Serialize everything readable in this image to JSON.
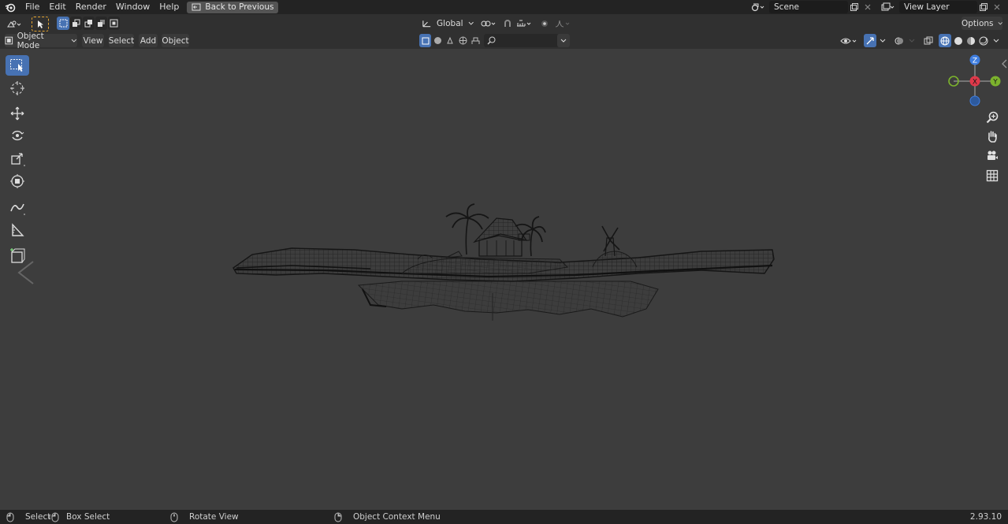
{
  "topbar": {
    "menus": [
      "File",
      "Edit",
      "Render",
      "Window",
      "Help"
    ],
    "back_label": "Back to Previous",
    "scene_name": "Scene",
    "view_layer": "View Layer"
  },
  "toolheader": {
    "orientation": "Global",
    "options_label": "Options"
  },
  "viewheader": {
    "mode": "Object Mode",
    "menus": [
      "View",
      "Select",
      "Add",
      "Object"
    ]
  },
  "gizmo": {
    "z": "Z",
    "x": "X",
    "y": "Y"
  },
  "statusbar": {
    "select": "Select",
    "box_select": "Box Select",
    "rotate_view": "Rotate View",
    "context_menu": "Object Context Menu",
    "version": "2.93.10"
  },
  "colors": {
    "accent": "#4772b3",
    "axis_x": "#e0394a",
    "axis_y": "#7cb32d",
    "axis_z": "#3f7ee0"
  }
}
